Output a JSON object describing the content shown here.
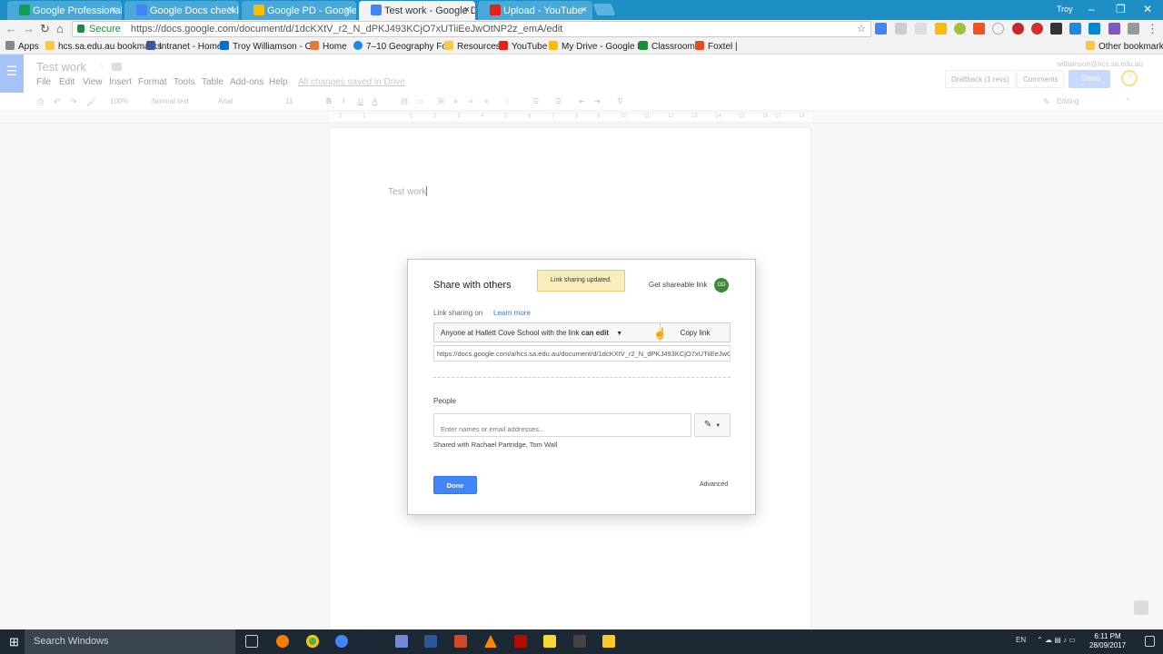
{
  "browser": {
    "tabs": [
      {
        "label": "Google Professional Dev",
        "color": "#0f9d58"
      },
      {
        "label": "Google Docs checklist -",
        "color": "#4285f4"
      },
      {
        "label": "Google PD - Google Driv",
        "color": "#fbbc05"
      },
      {
        "label": "Test work - Google Docs",
        "color": "#4285f4",
        "active": true
      },
      {
        "label": "Upload - YouTube",
        "color": "#e62117"
      }
    ],
    "user": "Troy",
    "url": "https://docs.google.com/document/d/1dcKXtV_r2_N_dPKJ493KCjO7xUTiiEeJwOtNP2z_emA/edit",
    "secure_label": "Secure",
    "bookmarks": [
      "Apps",
      "hcs.sa.edu.au bookmarks",
      "Intranet - Home",
      "Troy Williamson - Ou",
      "Home",
      "7–10 Geography Fou",
      "Resources",
      "YouTube",
      "My Drive - Google D",
      "Classroom",
      "Foxtel |"
    ],
    "other_bookmarks": "Other bookmarks"
  },
  "doc": {
    "title": "Test work",
    "menu": [
      "File",
      "Edit",
      "View",
      "Insert",
      "Format",
      "Tools",
      "Table",
      "Add-ons",
      "Help"
    ],
    "save_status": "All changes saved in Drive",
    "account": "williamson@hcs.sa.edu.au",
    "draftback": "Draftback (1 revs)",
    "comments": "Comments",
    "share": "Share",
    "help_glyph": "?",
    "body_text": "Test work",
    "toolbar": {
      "zoom": "100%",
      "style": "Normal text",
      "font": "Arial",
      "size": "11",
      "mode": "Editing"
    },
    "ruler_ticks": [
      "2",
      "1",
      "1",
      "2",
      "3",
      "4",
      "5",
      "6",
      "7",
      "8",
      "9",
      "10",
      "11",
      "12",
      "13",
      "14",
      "15",
      "16",
      "17",
      "18"
    ]
  },
  "share_dialog": {
    "title": "Share with others",
    "toast": "Link sharing updated.",
    "get_link": "Get shareable link",
    "link_icon_text": "GD",
    "sharing_state": "Link sharing on",
    "learn_more": "Learn more",
    "scope_prefix": "Anyone at Hallett Cove School with the link",
    "scope_permission": "can edit",
    "copy_link": "Copy link",
    "link_url": "https://docs.google.com/a/hcs.sa.edu.au/document/d/1dcKXtV_r2_N_dPKJ493KCjO7xUTiiEeJwOtNP2z_emA/edit?usp=sharing",
    "people_label": "People",
    "people_placeholder": "Enter names or email addresses...",
    "shared_with": "Shared with Rachael Partridge, Tom Wall",
    "done": "Done",
    "advanced": "Advanced"
  },
  "taskbar": {
    "search_placeholder": "Search Windows",
    "language": "EN",
    "time": "6:11 PM",
    "date": "28/09/2017"
  }
}
